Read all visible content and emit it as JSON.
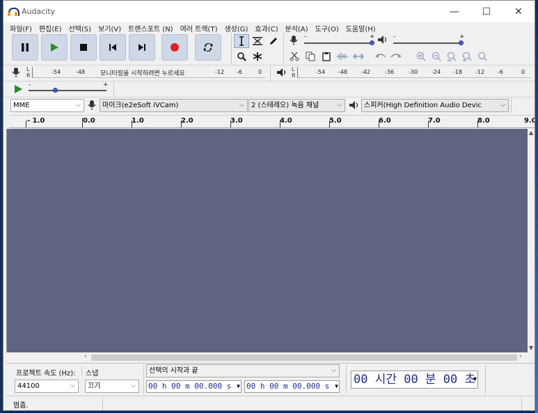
{
  "window": {
    "title": "Audacity",
    "min": "—",
    "max": "☐",
    "close": "✕"
  },
  "menu": [
    "파일(F)",
    "편집(E)",
    "선택(S)",
    "보기(V)",
    "트랜스포트 (N)",
    "여러 트랙(T)",
    "생성(G)",
    "효과(C)",
    "분석(A)",
    "도구(O)",
    "도움말(H)"
  ],
  "recording_meter": {
    "l": "L",
    "r": "R",
    "ticks": [
      "-54",
      "-48",
      "-12",
      "-6",
      "0"
    ],
    "message": "모니터링을 시작하려면 누르세요"
  },
  "playback_meter": {
    "l": "L",
    "r": "R",
    "ticks": [
      "-54",
      "-48",
      "-42",
      "-36",
      "-30",
      "-24",
      "-18",
      "-12",
      "-6",
      "0"
    ]
  },
  "mixer": {
    "minus": "-",
    "plus": "+"
  },
  "device": {
    "host": "MME",
    "mic": "마이크(e2eSoft iVCam)",
    "channels": "2 (스테레오) 녹음 채널",
    "speaker": "스피커(High Definition Audio Devic"
  },
  "ruler": {
    "ticks": [
      "- 1.0",
      "0.0",
      "1.0",
      "2.0",
      "3.0",
      "4.0",
      "5.0",
      "6.0",
      "7.0",
      "8.0",
      "9.0"
    ]
  },
  "bottom": {
    "rate_label": "프로젝트 속도 (Hz):",
    "snap_label": "스냅",
    "rate_value": "44100",
    "snap_value": "끄기",
    "selection_mode": "선택의 시작과 끝",
    "start_time": "00 h 00 m 00.000 s",
    "end_time": "00 h 00 m 00.000 s",
    "audio_position": "00 시간 00 분 00 초"
  },
  "status": {
    "text": "멈춤."
  }
}
